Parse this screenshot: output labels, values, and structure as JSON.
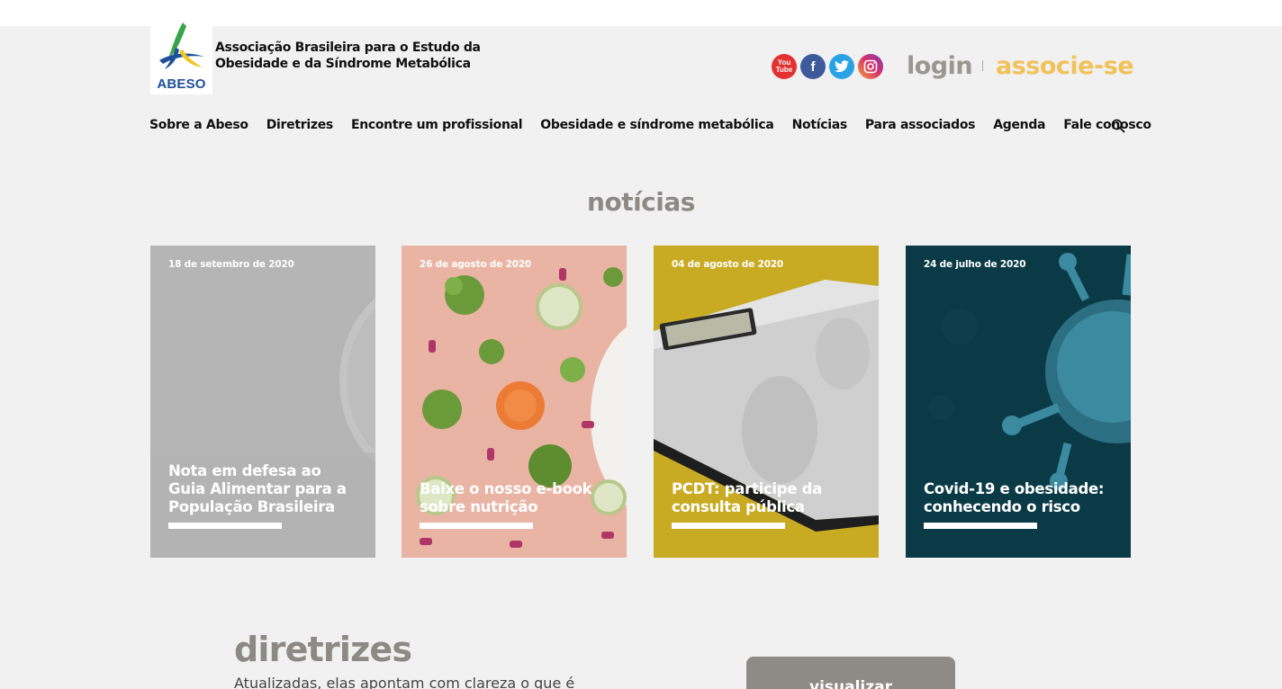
{
  "header": {
    "logo_text": "ABESO",
    "org_name": "Associação Brasileira para o Estudo da Obesidade e da Síndrome Metabólica",
    "socials": [
      {
        "icon": "youtube-icon",
        "label": "You Tube",
        "color": "#e2312f"
      },
      {
        "icon": "facebook-icon",
        "label": "f",
        "color": "#3d5a9b"
      },
      {
        "icon": "twitter-icon",
        "label": "",
        "color": "#2aa3e6"
      },
      {
        "icon": "instagram-icon",
        "label": "",
        "color": "#c13584"
      }
    ],
    "login": "login",
    "associe": "associe-se",
    "accent_color": "#f2c25a"
  },
  "nav": {
    "items": [
      "Sobre a Abeso",
      "Diretrizes",
      "Encontre um profissional",
      "Obesidade e síndrome metabólica",
      "Notícias",
      "Para associados",
      "Agenda",
      "Fale conosco"
    ],
    "search_icon": "search-icon"
  },
  "noticias": {
    "title": "notícias",
    "cards": [
      {
        "date": "18 de setembro de 2020",
        "title": "Nota em defesa ao Guia Alimentar para a População Brasileira"
      },
      {
        "date": "26 de agosto de 2020",
        "title": "Baixe o nosso e-book sobre nutrição"
      },
      {
        "date": "04 de agosto de 2020",
        "title": "PCDT: participe da consulta pública"
      },
      {
        "date": "24 de julho de 2020",
        "title": "Covid-19 e obesidade: conhecendo o risco"
      }
    ]
  },
  "diretrizes": {
    "title": "diretrizes",
    "text": "Atualizadas, elas apontam com clareza o que é",
    "button": "visualizar"
  }
}
